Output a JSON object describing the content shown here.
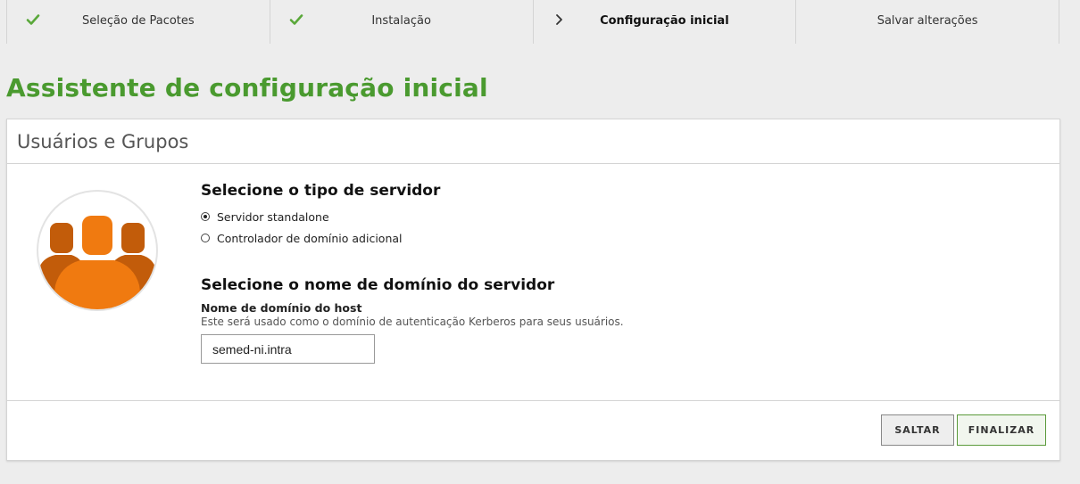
{
  "steps": [
    {
      "label": "Seleção de Pacotes",
      "status": "done",
      "icon": "check-icon"
    },
    {
      "label": "Instalação",
      "status": "done",
      "icon": "check-icon"
    },
    {
      "label": "Configuração inicial",
      "status": "current",
      "icon": "chevron-right-icon"
    },
    {
      "label": "Salvar alterações",
      "status": "pending",
      "icon": ""
    }
  ],
  "page": {
    "title": "Assistente de configuração inicial"
  },
  "panel": {
    "header": "Usuários e Grupos",
    "server_type": {
      "heading": "Selecione o tipo de servidor",
      "options": [
        {
          "label": "Servidor standalone",
          "selected": true
        },
        {
          "label": "Controlador de domínio adicional",
          "selected": false
        }
      ]
    },
    "domain": {
      "heading": "Selecione o nome de domínio do servidor",
      "field_label": "Nome de domínio do host",
      "field_help": "Este será usado como o domínio de autenticação Kerberos para seus usuários.",
      "value": "semed-ni.intra"
    },
    "buttons": {
      "skip": "SALTAR",
      "finish": "FINALIZAR"
    }
  },
  "colors": {
    "accent_green": "#4a9a2f",
    "check_green": "#5aa83a",
    "avatar_orange": "#f07a10",
    "avatar_dark_orange": "#c25c0a"
  }
}
